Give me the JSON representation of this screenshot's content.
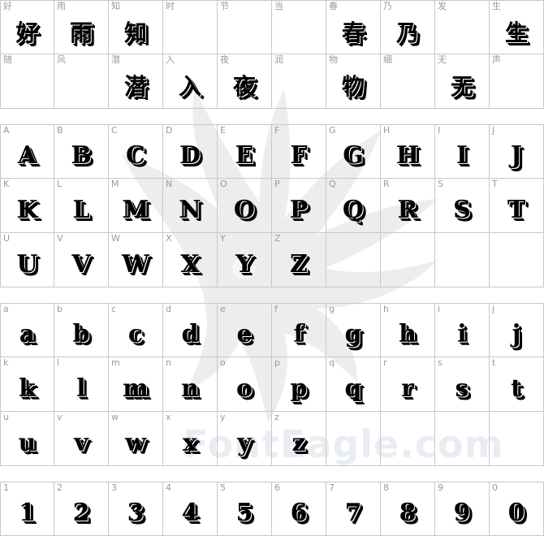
{
  "watermark": {
    "text": "FontEagle.com",
    "icon": "eagle-icon"
  },
  "sections": [
    {
      "id": "cjk",
      "cells": [
        {
          "label": "好",
          "glyph": "好"
        },
        {
          "label": "雨",
          "glyph": "雨"
        },
        {
          "label": "知",
          "glyph": "知"
        },
        {
          "label": "时",
          "glyph": ""
        },
        {
          "label": "节",
          "glyph": ""
        },
        {
          "label": "当",
          "glyph": ""
        },
        {
          "label": "春",
          "glyph": "春"
        },
        {
          "label": "乃",
          "glyph": "乃"
        },
        {
          "label": "发",
          "glyph": ""
        },
        {
          "label": "生",
          "glyph": "生"
        },
        {
          "label": "随",
          "glyph": ""
        },
        {
          "label": "风",
          "glyph": ""
        },
        {
          "label": "潜",
          "glyph": "潜"
        },
        {
          "label": "入",
          "glyph": "入"
        },
        {
          "label": "夜",
          "glyph": "夜"
        },
        {
          "label": "润",
          "glyph": ""
        },
        {
          "label": "物",
          "glyph": "物"
        },
        {
          "label": "细",
          "glyph": ""
        },
        {
          "label": "无",
          "glyph": "无"
        },
        {
          "label": "声",
          "glyph": ""
        }
      ]
    },
    {
      "id": "uppercase",
      "cells": [
        {
          "label": "A",
          "glyph": "A"
        },
        {
          "label": "B",
          "glyph": "B"
        },
        {
          "label": "C",
          "glyph": "C"
        },
        {
          "label": "D",
          "glyph": "D"
        },
        {
          "label": "E",
          "glyph": "E"
        },
        {
          "label": "F",
          "glyph": "F"
        },
        {
          "label": "G",
          "glyph": "G"
        },
        {
          "label": "H",
          "glyph": "H"
        },
        {
          "label": "I",
          "glyph": "I"
        },
        {
          "label": "J",
          "glyph": "J"
        },
        {
          "label": "K",
          "glyph": "K"
        },
        {
          "label": "L",
          "glyph": "L"
        },
        {
          "label": "M",
          "glyph": "M"
        },
        {
          "label": "N",
          "glyph": "N"
        },
        {
          "label": "O",
          "glyph": "O"
        },
        {
          "label": "P",
          "glyph": "P"
        },
        {
          "label": "Q",
          "glyph": "Q"
        },
        {
          "label": "R",
          "glyph": "R"
        },
        {
          "label": "S",
          "glyph": "S"
        },
        {
          "label": "T",
          "glyph": "T"
        },
        {
          "label": "U",
          "glyph": "U"
        },
        {
          "label": "V",
          "glyph": "V"
        },
        {
          "label": "W",
          "glyph": "W"
        },
        {
          "label": "X",
          "glyph": "X"
        },
        {
          "label": "Y",
          "glyph": "Y"
        },
        {
          "label": "Z",
          "glyph": "Z"
        },
        {
          "label": "",
          "glyph": ""
        },
        {
          "label": "",
          "glyph": ""
        },
        {
          "label": "",
          "glyph": ""
        },
        {
          "label": "",
          "glyph": ""
        }
      ]
    },
    {
      "id": "lowercase",
      "cells": [
        {
          "label": "a",
          "glyph": "a"
        },
        {
          "label": "b",
          "glyph": "b"
        },
        {
          "label": "c",
          "glyph": "c"
        },
        {
          "label": "d",
          "glyph": "d"
        },
        {
          "label": "e",
          "glyph": "e"
        },
        {
          "label": "f",
          "glyph": "f"
        },
        {
          "label": "g",
          "glyph": "g"
        },
        {
          "label": "h",
          "glyph": "h"
        },
        {
          "label": "i",
          "glyph": "i"
        },
        {
          "label": "j",
          "glyph": "j"
        },
        {
          "label": "k",
          "glyph": "k"
        },
        {
          "label": "l",
          "glyph": "l"
        },
        {
          "label": "m",
          "glyph": "m"
        },
        {
          "label": "n",
          "glyph": "n"
        },
        {
          "label": "o",
          "glyph": "o"
        },
        {
          "label": "p",
          "glyph": "p"
        },
        {
          "label": "q",
          "glyph": "q"
        },
        {
          "label": "r",
          "glyph": "r"
        },
        {
          "label": "s",
          "glyph": "s"
        },
        {
          "label": "t",
          "glyph": "t"
        },
        {
          "label": "u",
          "glyph": "u"
        },
        {
          "label": "v",
          "glyph": "v"
        },
        {
          "label": "w",
          "glyph": "w"
        },
        {
          "label": "x",
          "glyph": "x"
        },
        {
          "label": "y",
          "glyph": "y"
        },
        {
          "label": "z",
          "glyph": "z"
        },
        {
          "label": "",
          "glyph": ""
        },
        {
          "label": "",
          "glyph": ""
        },
        {
          "label": "",
          "glyph": ""
        },
        {
          "label": "",
          "glyph": ""
        }
      ]
    },
    {
      "id": "digits",
      "cells": [
        {
          "label": "1",
          "glyph": "1"
        },
        {
          "label": "2",
          "glyph": "2"
        },
        {
          "label": "3",
          "glyph": "3"
        },
        {
          "label": "4",
          "glyph": "4"
        },
        {
          "label": "5",
          "glyph": "5"
        },
        {
          "label": "6",
          "glyph": "6"
        },
        {
          "label": "7",
          "glyph": "7"
        },
        {
          "label": "8",
          "glyph": "8"
        },
        {
          "label": "9",
          "glyph": "9"
        },
        {
          "label": "0",
          "glyph": "0"
        }
      ]
    }
  ]
}
